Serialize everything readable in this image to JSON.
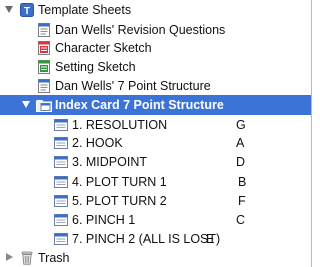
{
  "binder": {
    "template_sheets": {
      "label": "Template Sheets",
      "expanded": true,
      "children": [
        {
          "label": "Dan Wells' Revision Questions",
          "icon": "text-document-icon"
        },
        {
          "label": "Character Sketch",
          "icon": "character-sketch-icon"
        },
        {
          "label": "Setting Sketch",
          "icon": "setting-sketch-icon"
        },
        {
          "label": "Dan Wells' 7 Point Structure",
          "icon": "text-document-icon"
        }
      ]
    },
    "index_card_folder": {
      "label": "Index Card 7 Point Structure",
      "selected": true,
      "expanded": true,
      "children": [
        {
          "label": "1. RESOLUTION",
          "code": "G"
        },
        {
          "label": "2. HOOK",
          "code": "A"
        },
        {
          "label": "3. MIDPOINT",
          "code": "D"
        },
        {
          "label": "4. PLOT TURN 1",
          "code": "B"
        },
        {
          "label": "5. PLOT TURN 2",
          "code": "F"
        },
        {
          "label": "6. PINCH 1",
          "code": "C"
        },
        {
          "label": "7. PINCH 2 (ALL IS LOST)",
          "code": "E"
        }
      ]
    },
    "trash": {
      "label": "Trash",
      "expanded": false
    }
  },
  "colors": {
    "selection": "#3b74d6",
    "template_icon": "#3d6fc9",
    "character_icon": "#d8363c",
    "setting_icon": "#2f9a3b"
  }
}
